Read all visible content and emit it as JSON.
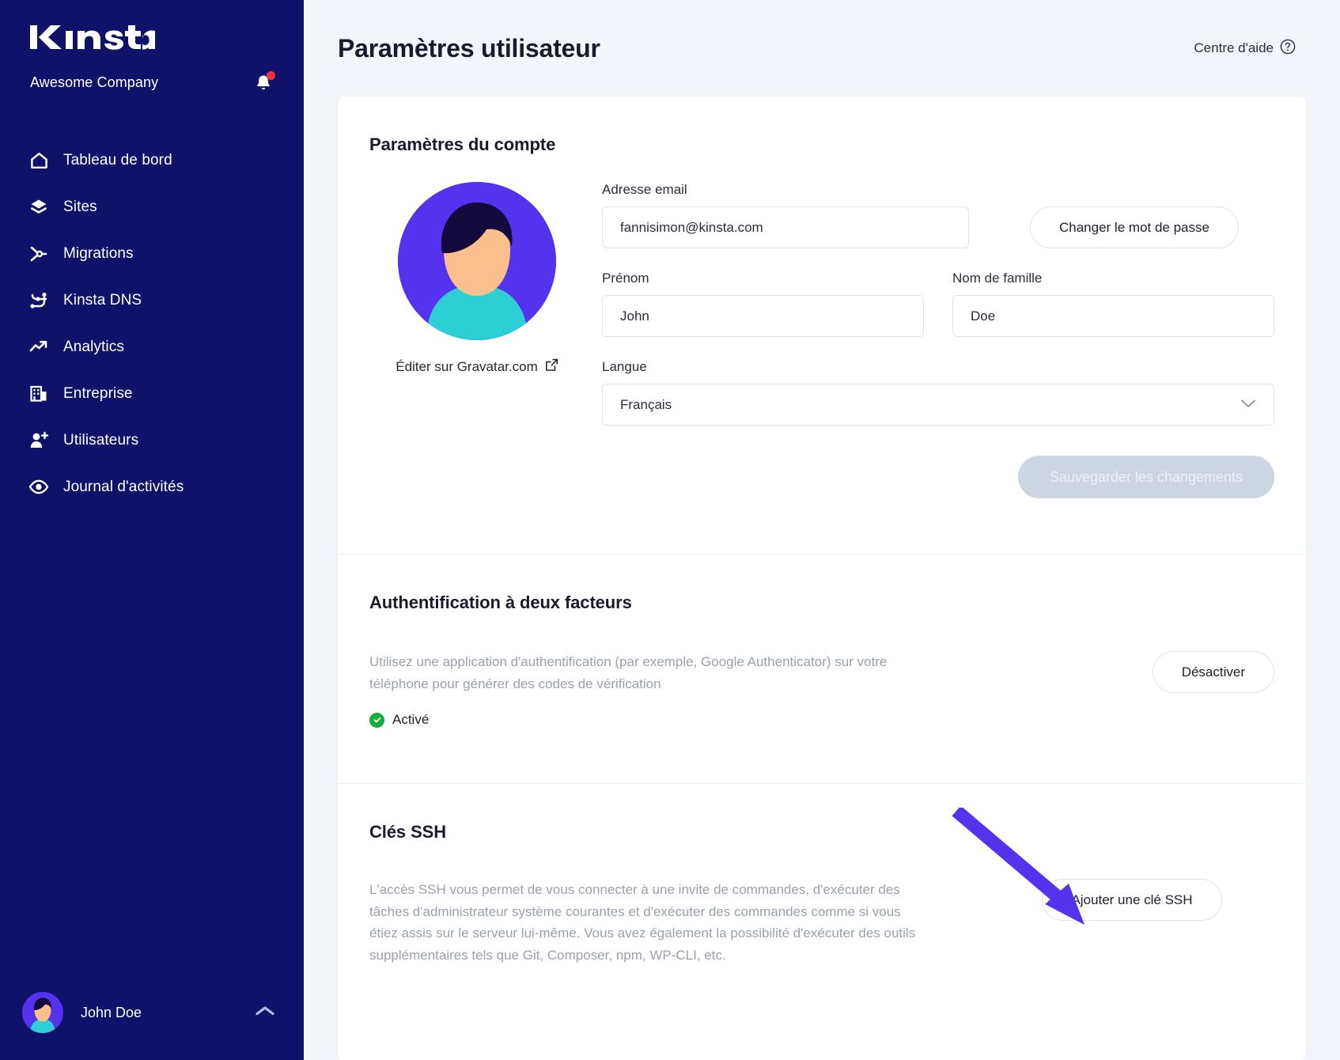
{
  "sidebar": {
    "logo": "Kinsta",
    "company": "Awesome Company",
    "notification_icon": "bell-icon",
    "items": [
      {
        "label": "Tableau de bord",
        "icon": "home-icon"
      },
      {
        "label": "Sites",
        "icon": "layers-icon"
      },
      {
        "label": "Migrations",
        "icon": "merge-icon"
      },
      {
        "label": "Kinsta DNS",
        "icon": "dns-nodes-icon"
      },
      {
        "label": "Analytics",
        "icon": "trend-up-icon"
      },
      {
        "label": "Entreprise",
        "icon": "building-icon"
      },
      {
        "label": "Utilisateurs",
        "icon": "user-plus-icon"
      },
      {
        "label": "Journal d'activités",
        "icon": "eye-icon"
      }
    ],
    "footer": {
      "name": "John Doe",
      "chevron_icon": "chevron-up-icon",
      "avatar_icon": "avatar"
    }
  },
  "header": {
    "title": "Paramètres utilisateur",
    "help_label": "Centre d'aide",
    "help_icon": "question-circle-icon"
  },
  "account": {
    "title": "Paramètres du compte",
    "gravatar_link": "Éditer sur Gravatar.com",
    "gravatar_icon": "external-link-icon",
    "email_label": "Adresse email",
    "email_value": "fannisimon@kinsta.com",
    "change_password_label": "Changer le mot de passe",
    "firstname_label": "Prénom",
    "firstname_value": "John",
    "lastname_label": "Nom de famille",
    "lastname_value": "Doe",
    "language_label": "Langue",
    "language_value": "Français",
    "language_chevron_icon": "chevron-down-icon",
    "save_label": "Sauvegarder les changements"
  },
  "two_factor": {
    "title": "Authentification à deux facteurs",
    "description": "Utilisez une application d'authentification (par exemple, Google Authenticator) sur votre téléphone pour générer des codes de vérification",
    "status": "Activé",
    "status_icon": "check-circle-icon",
    "disable_label": "Désactiver"
  },
  "ssh": {
    "title": "Clés SSH",
    "description": "L'accès SSH vous permet de vous connecter à une invite de commandes, d'exécuter des tâches d'administrateur système courantes et d'exécuter des commandes comme si vous étiez assis sur le serveur lui-même. Vous avez également la possibilité d'exécuter des outils supplémentaires tels que Git, Composer, npm, WP-CLI, etc.",
    "add_key_label": "Ajouter une clé SSH",
    "annotation_icon": "arrow-annotation"
  },
  "colors": {
    "sidebar_bg": "#0f1268",
    "accent_purple": "#5533ee",
    "notification_red": "#f5333f",
    "success_green": "#14ae3c",
    "page_bg": "#f2f5fa",
    "muted_text": "#9aa0ae",
    "disabled_button": "#ced5e2"
  }
}
